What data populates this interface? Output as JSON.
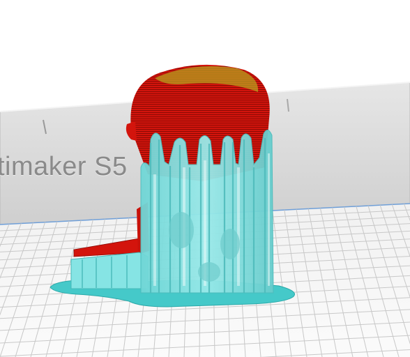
{
  "scene": {
    "printer_back_panel_label": "timaker S5"
  },
  "colors": {
    "background": "#ffffff",
    "back_panel": "#dadada",
    "build_plate": "#f7f7f7",
    "grid_line": "#c8c8c8",
    "model_red": "#d11a10",
    "model_highlight": "#b8a820",
    "support_cyan": "#84e2e2",
    "support_dark": "#5cc5c5",
    "raft_cyan": "#43c7c7"
  }
}
